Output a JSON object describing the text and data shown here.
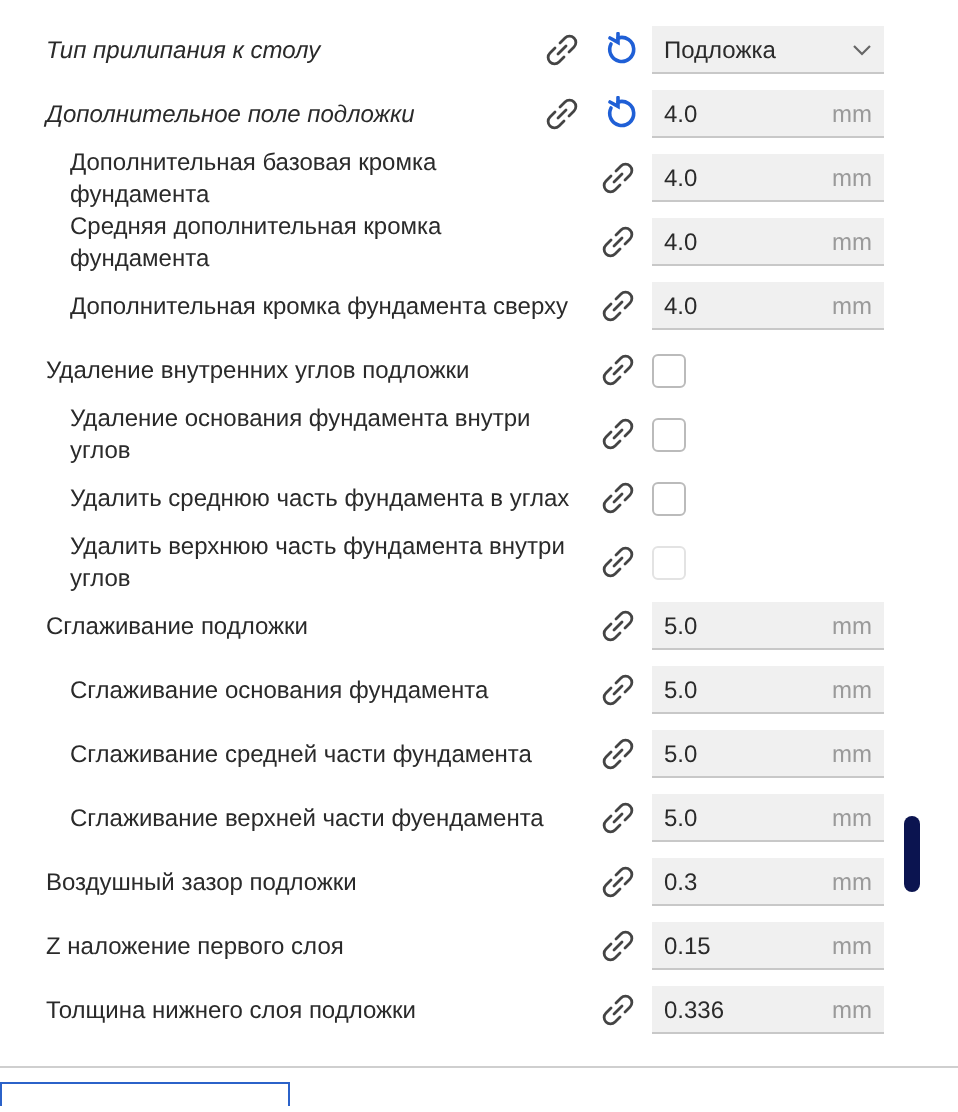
{
  "settings": [
    {
      "label": "Тип прилипания к столу",
      "kind": "dropdown",
      "value": "Подложка",
      "modified": true
    },
    {
      "label": "Дополнительное поле подложки",
      "kind": "number",
      "value": "4.0",
      "unit": "mm",
      "modified": true,
      "children": [
        {
          "label": "Дополнительная базовая кромка фундамента",
          "kind": "number",
          "value": "4.0",
          "unit": "mm",
          "modified": false
        },
        {
          "label": "Средняя дополнительная кромка фундамента",
          "kind": "number",
          "value": "4.0",
          "unit": "mm",
          "modified": false
        },
        {
          "label": "Дополнительная кромка фундамента сверху",
          "kind": "number",
          "value": "4.0",
          "unit": "mm",
          "modified": false
        }
      ]
    },
    {
      "label": "Удаление внутренних углов подложки",
      "kind": "checkbox",
      "checked": false,
      "disabled": false,
      "modified": false,
      "children": [
        {
          "label": "Удаление основания фундамента внутри углов",
          "kind": "checkbox",
          "checked": false,
          "disabled": false,
          "modified": false
        },
        {
          "label": "Удалить среднюю часть фундамента в углах",
          "kind": "checkbox",
          "checked": false,
          "disabled": false,
          "modified": false
        },
        {
          "label": "Удалить верхнюю часть фундамента внутри углов",
          "kind": "checkbox",
          "checked": false,
          "disabled": true,
          "modified": false
        }
      ]
    },
    {
      "label": "Сглаживание подложки",
      "kind": "number",
      "value": "5.0",
      "unit": "mm",
      "modified": false,
      "children": [
        {
          "label": "Сглаживание основания фундамента",
          "kind": "number",
          "value": "5.0",
          "unit": "mm",
          "modified": false
        },
        {
          "label": "Сглаживание средней части фундамента",
          "kind": "number",
          "value": "5.0",
          "unit": "mm",
          "modified": false
        },
        {
          "label": "Сглаживание верхней части фуендамента",
          "kind": "number",
          "value": "5.0",
          "unit": "mm",
          "modified": false
        }
      ]
    },
    {
      "label": "Воздушный зазор подложки",
      "kind": "number",
      "value": "0.3",
      "unit": "mm",
      "modified": false
    },
    {
      "label": "Z наложение первого слоя",
      "kind": "number",
      "value": "0.15",
      "unit": "mm",
      "modified": false
    },
    {
      "label": "Толщина нижнего слоя подложки",
      "kind": "number",
      "value": "0.336",
      "unit": "mm",
      "modified": false
    }
  ]
}
